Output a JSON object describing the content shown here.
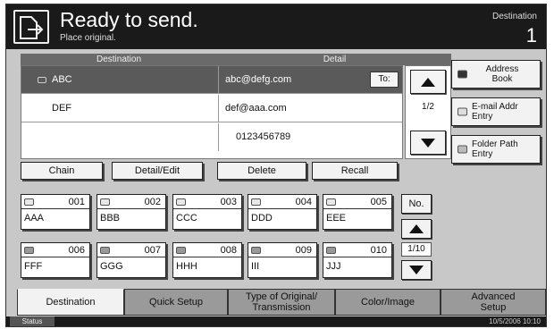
{
  "header": {
    "title": "Ready to send.",
    "subtitle": "Place original.",
    "destination_label": "Destination",
    "destination_count": "1"
  },
  "list": {
    "col_destination": "Destination",
    "col_detail": "Detail",
    "rows": [
      {
        "name": "ABC",
        "detail": "abc@defg.com",
        "to_label": "To:"
      },
      {
        "name": "DEF",
        "detail": "def@aaa.com"
      },
      {
        "name": "",
        "detail": "0123456789"
      }
    ],
    "page": "1/2"
  },
  "actions": {
    "chain": "Chain",
    "detail_edit": "Detail/Edit",
    "delete": "Delete",
    "recall": "Recall"
  },
  "side": {
    "address_book": "Address Book",
    "email_addr_entry": "E-mail Addr Entry",
    "folder_path_entry": "Folder Path Entry"
  },
  "one_touch": {
    "keys": [
      {
        "num": "001",
        "name": "AAA",
        "icon": "mail-icon"
      },
      {
        "num": "002",
        "name": "BBB",
        "icon": "mail-icon"
      },
      {
        "num": "003",
        "name": "CCC",
        "icon": "mail-icon"
      },
      {
        "num": "004",
        "name": "DDD",
        "icon": "mail-icon"
      },
      {
        "num": "005",
        "name": "EEE",
        "icon": "mail-icon"
      },
      {
        "num": "006",
        "name": "FFF",
        "icon": "folder-icon"
      },
      {
        "num": "007",
        "name": "GGG",
        "icon": "folder-icon"
      },
      {
        "num": "008",
        "name": "HHH",
        "icon": "folder-icon"
      },
      {
        "num": "009",
        "name": "III",
        "icon": "folder-icon"
      },
      {
        "num": "010",
        "name": "JJJ",
        "icon": "folder-icon"
      }
    ],
    "no_label": "No.",
    "page": "1/10"
  },
  "tabs": [
    "Destination",
    "Quick Setup",
    "Type of Original/ Transmission",
    "Color/Image",
    "Advanced Setup"
  ],
  "status": {
    "label": "Status",
    "datetime": "10/5/2006   10:10"
  }
}
